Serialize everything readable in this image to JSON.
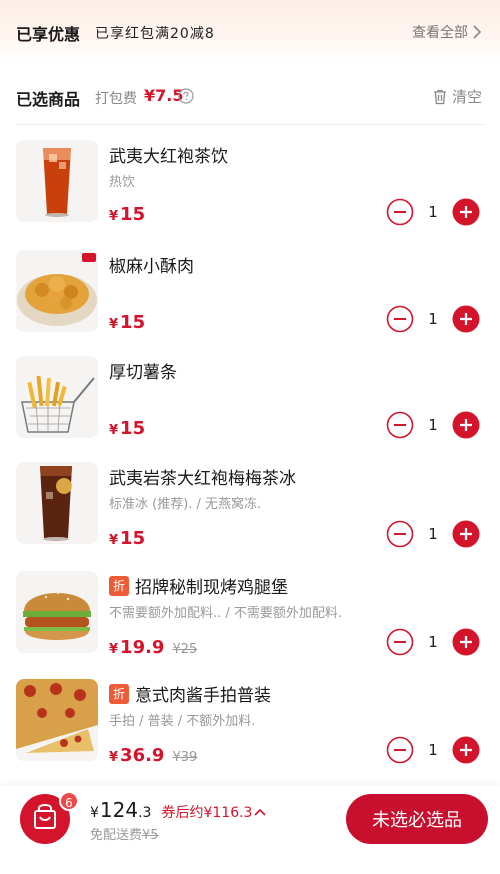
{
  "discount": {
    "title": "已享优惠",
    "desc": "已享红包满20减8",
    "view_all": "查看全部"
  },
  "selected": {
    "title": "已选商品",
    "pack_label": "打包费",
    "pack_price": "¥7.5",
    "clear_label": "清空"
  },
  "items": [
    {
      "name": "武夷大红袍茶饮",
      "spec": "热饮",
      "yen": "¥",
      "price": "15",
      "orig_price": "",
      "qty": "1",
      "badge": ""
    },
    {
      "name": "椒麻小酥肉",
      "spec": "",
      "yen": "¥",
      "price": "15",
      "orig_price": "",
      "qty": "1",
      "badge": ""
    },
    {
      "name": "厚切薯条",
      "spec": "",
      "yen": "¥",
      "price": "15",
      "orig_price": "",
      "qty": "1",
      "badge": ""
    },
    {
      "name": "武夷岩茶大红袍梅梅茶冰",
      "spec": "标准冰 (推荐). / 无燕窝冻.",
      "yen": "¥",
      "price": "15",
      "orig_price": "",
      "qty": "1",
      "badge": ""
    },
    {
      "name": "招牌秘制现烤鸡腿堡",
      "spec": "不需要额外加配料.. / 不需要额外加配料.",
      "yen": "¥",
      "price": "19.9",
      "orig_price": "¥25",
      "qty": "1",
      "badge": "折"
    },
    {
      "name": "意式肉酱手拍普装",
      "spec": "手拍 / 普装 / 不额外加料.",
      "yen": "¥",
      "price": "36.9",
      "orig_price": "¥39",
      "qty": "1",
      "badge": "折"
    }
  ],
  "bottom": {
    "cart_count": "6",
    "yen": "¥",
    "total_int": "124",
    "total_dec": ".3",
    "after_coupon": "券后约¥116.3",
    "delivery_label": "免配送费",
    "delivery_orig": "¥5",
    "checkout_label": "未选必选品"
  },
  "colors": {
    "accent": "#d4142a",
    "button": "#c8102e",
    "discount_badge": "#ec5d37"
  },
  "icons": [
    "chevron-right-icon",
    "help-circle-icon",
    "trash-icon",
    "minus-circle-icon",
    "plus-circle-icon",
    "shopping-bag-icon",
    "chevron-up-icon"
  ]
}
